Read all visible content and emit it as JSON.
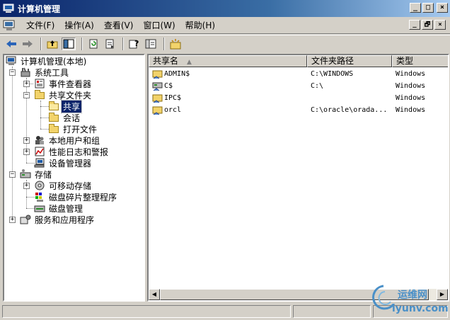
{
  "window": {
    "title": "计算机管理",
    "buttons": [
      "_",
      "□",
      "×"
    ]
  },
  "menu": {
    "items": [
      "文件(F)",
      "操作(A)",
      "查看(V)",
      "窗口(W)",
      "帮助(H)"
    ],
    "mdi_buttons": [
      "_",
      "🗗",
      "×"
    ]
  },
  "toolbar": {
    "buttons": [
      "back-icon",
      "forward-icon",
      "up-folder-icon",
      "show-tree-icon",
      "refresh-icon",
      "export-list-icon",
      "help-icon",
      "properties-icon",
      "new-share-icon"
    ]
  },
  "tree": {
    "root": "计算机管理(本地)",
    "system_tools": "系统工具",
    "event_viewer": "事件查看器",
    "shared_folders": "共享文件夹",
    "shares": "共享",
    "sessions": "会话",
    "open_files": "打开文件",
    "local_users": "本地用户和组",
    "perf_logs": "性能日志和警报",
    "device_manager": "设备管理器",
    "storage": "存储",
    "removable_storage": "可移动存储",
    "disk_defrag": "磁盘碎片整理程序",
    "disk_management": "磁盘管理",
    "services_apps": "服务和应用程序"
  },
  "list": {
    "columns": [
      "共享名",
      "文件夹路径",
      "类型"
    ],
    "sort_indicator": "▲",
    "rows": [
      {
        "name": "ADMIN$",
        "path": "C:\\WINDOWS",
        "type": "Windows"
      },
      {
        "name": "C$",
        "path": "C:\\",
        "type": "Windows"
      },
      {
        "name": "IPC$",
        "path": "",
        "type": "Windows"
      },
      {
        "name": "orcl",
        "path": "C:\\oracle\\orada...",
        "type": "Windows"
      }
    ]
  },
  "watermark": {
    "line1": "运维网",
    "line2": "iyunv.com"
  },
  "colors": {
    "titlebar": "#0a246a",
    "selection": "#0a246a",
    "window_bg": "#d4d0c8",
    "folder": "#f2d36b"
  }
}
